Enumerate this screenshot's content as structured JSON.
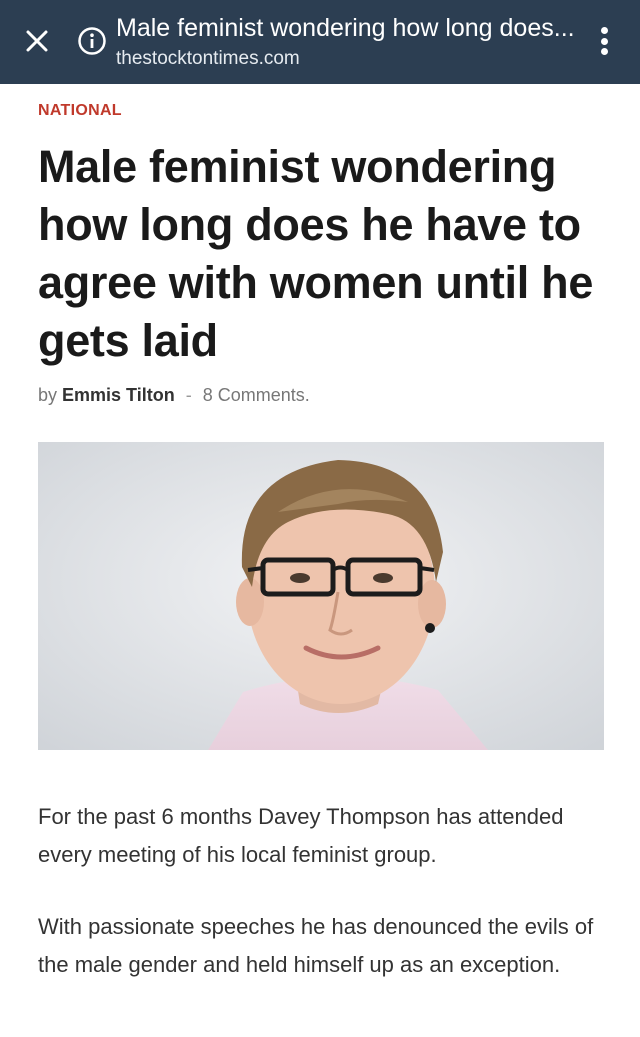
{
  "browser": {
    "title": "Male feminist wondering how long does...",
    "url": "thestocktontimes.com",
    "icons": [
      "close-icon",
      "info-icon",
      "more-vert-icon"
    ]
  },
  "article": {
    "category": "NATIONAL",
    "headline": "Male feminist wondering how long does he have to agree with women until he gets laid",
    "byline": {
      "prefix": "by",
      "author": "Emmis Tilton",
      "separator": "-",
      "comments": "8 Comments."
    },
    "paragraphs": [
      "For the past 6 months Davey Thompson has attended every meeting of his local feminist group.",
      "With passionate speeches he has denounced the evils of the male gender and held himself up as an exception."
    ]
  },
  "colors": {
    "topbar": "#2c3e52",
    "category": "#c0392b",
    "headline": "#1a1a1a",
    "body": "#333333"
  }
}
